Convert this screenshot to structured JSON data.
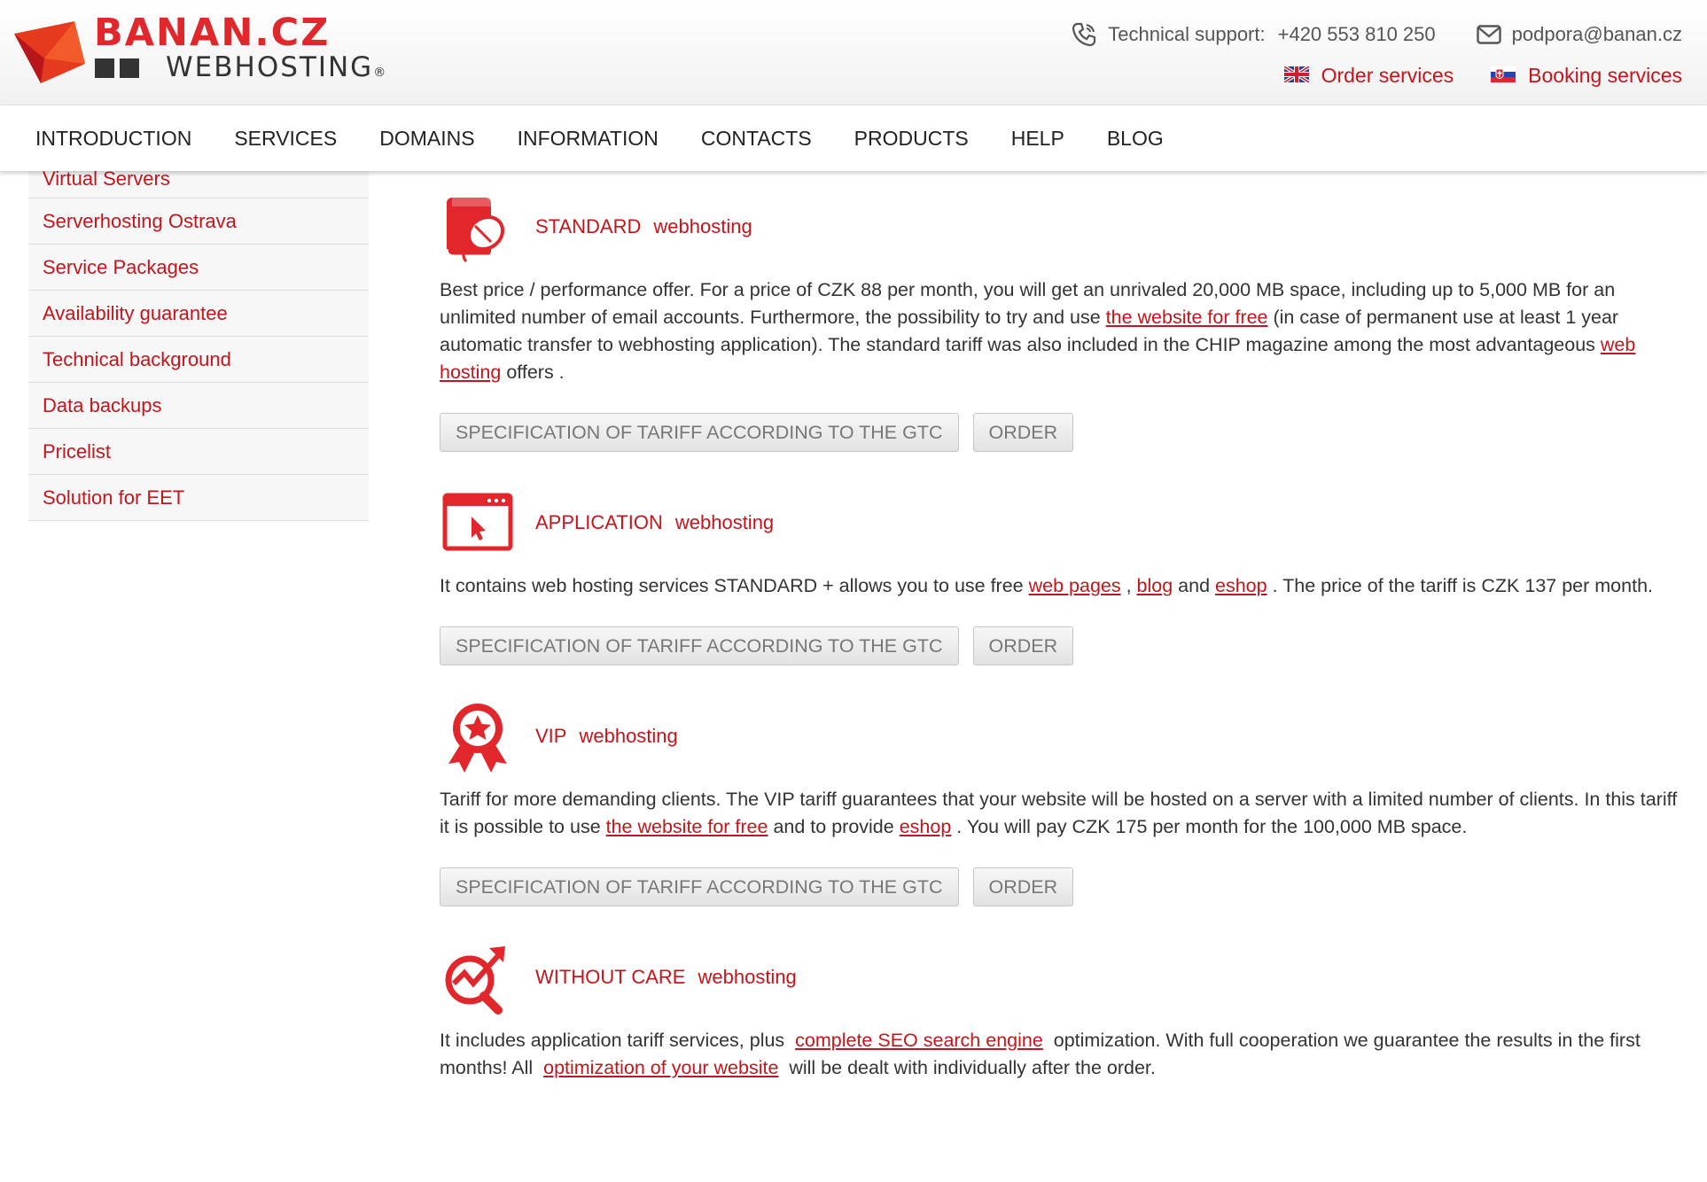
{
  "logo": {
    "title": "BANAN.CZ",
    "subtitle": "WEBHOSTING",
    "reg": "®"
  },
  "contact": {
    "support_label": "Technical support:",
    "support_phone": "+420 553 810 250",
    "email": "podpora@banan.cz"
  },
  "top_links": {
    "order": "Order services",
    "booking": "Booking services"
  },
  "nav": [
    "INTRODUCTION",
    "SERVICES",
    "DOMAINS",
    "INFORMATION",
    "CONTACTS",
    "PRODUCTS",
    "HELP",
    "BLOG"
  ],
  "sidebar": [
    "Virtual Servers",
    "Serverhosting Ostrava",
    "Service Packages",
    "Availability guarantee",
    "Technical background",
    "Data backups",
    "Pricelist",
    "Solution for EET"
  ],
  "buttons": {
    "spec": "SPECIFICATION OF TARIFF ACCORDING TO THE GTC",
    "order": "ORDER"
  },
  "tariffs": [
    {
      "name": "STANDARD",
      "kind": "webhosting",
      "icon": "book-mouse-icon",
      "text": [
        "Best price / performance offer. For a price of CZK 88 per month, you will get an unrivaled 20,000 MB space, including up to 5,000 MB for an unlimited number of email accounts. Furthermore, the possibility to try and use ",
        "the website for free",
        " (in case of permanent use at least 1 year automatic transfer to webhosting application). The standard tariff was also included in the CHIP magazine among the most advantageous ",
        "web hosting",
        " offers ."
      ]
    },
    {
      "name": "APPLICATION",
      "kind": "webhosting",
      "icon": "browser-cursor-icon",
      "text": [
        "It contains web hosting services STANDARD + allows you to use free ",
        "web pages",
        " , ",
        "blog",
        " and ",
        "eshop",
        " . The price of the tariff is CZK 137 per month."
      ]
    },
    {
      "name": "VIP",
      "kind": "webhosting",
      "icon": "award-star-icon",
      "text": [
        "Tariff for more demanding clients. The VIP tariff guarantees that your website will be hosted on a server with a limited number of clients. In this tariff it is possible to use ",
        "the website for free",
        " and to provide ",
        "eshop",
        " . You will pay CZK 175 per month for the 100,000 MB space."
      ]
    },
    {
      "name": "WITHOUT CARE",
      "kind": "webhosting",
      "icon": "seo-magnifier-icon",
      "text": [
        "It includes application tariff services, plus  ",
        "complete SEO search engine",
        "  optimization. With full cooperation we guarantee the results in the first months! All  ",
        "optimization of your website",
        "  will be dealt with individually after the order."
      ]
    }
  ],
  "colors": {
    "brand": "#c3161c",
    "logo_red": "#e0282c"
  }
}
